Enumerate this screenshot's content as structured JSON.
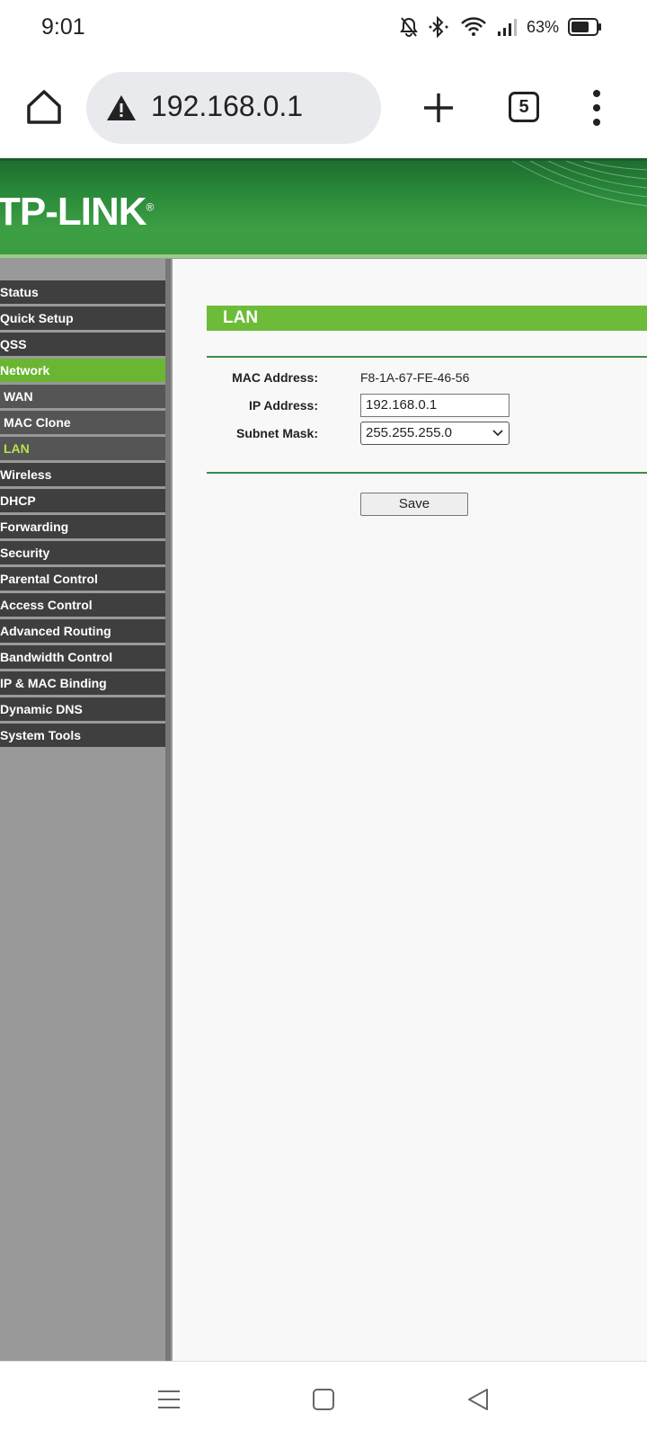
{
  "status_bar": {
    "time": "9:01",
    "battery": "63%"
  },
  "browser": {
    "url": "192.168.0.1",
    "tab_count": "5"
  },
  "brand": {
    "logo": "TP-LINK",
    "reg_mark": "®",
    "accent": "#6ab531",
    "banner_color": "#2a8a3a"
  },
  "sidebar": {
    "items": [
      {
        "label": "Status"
      },
      {
        "label": "Quick Setup"
      },
      {
        "label": "QSS"
      },
      {
        "label": "Network"
      },
      {
        "label": "WAN"
      },
      {
        "label": "MAC Clone"
      },
      {
        "label": "LAN"
      },
      {
        "label": "Wireless"
      },
      {
        "label": "DHCP"
      },
      {
        "label": "Forwarding"
      },
      {
        "label": "Security"
      },
      {
        "label": "Parental Control"
      },
      {
        "label": "Access Control"
      },
      {
        "label": "Advanced Routing"
      },
      {
        "label": "Bandwidth Control"
      },
      {
        "label": "IP & MAC Binding"
      },
      {
        "label": "Dynamic DNS"
      },
      {
        "label": "System Tools"
      }
    ]
  },
  "lan": {
    "title": "LAN",
    "mac_label": "MAC Address:",
    "mac_value": "F8-1A-67-FE-46-56",
    "ip_label": "IP Address:",
    "ip_value": "192.168.0.1",
    "mask_label": "Subnet Mask:",
    "mask_value": "255.255.255.0",
    "save_label": "Save"
  }
}
